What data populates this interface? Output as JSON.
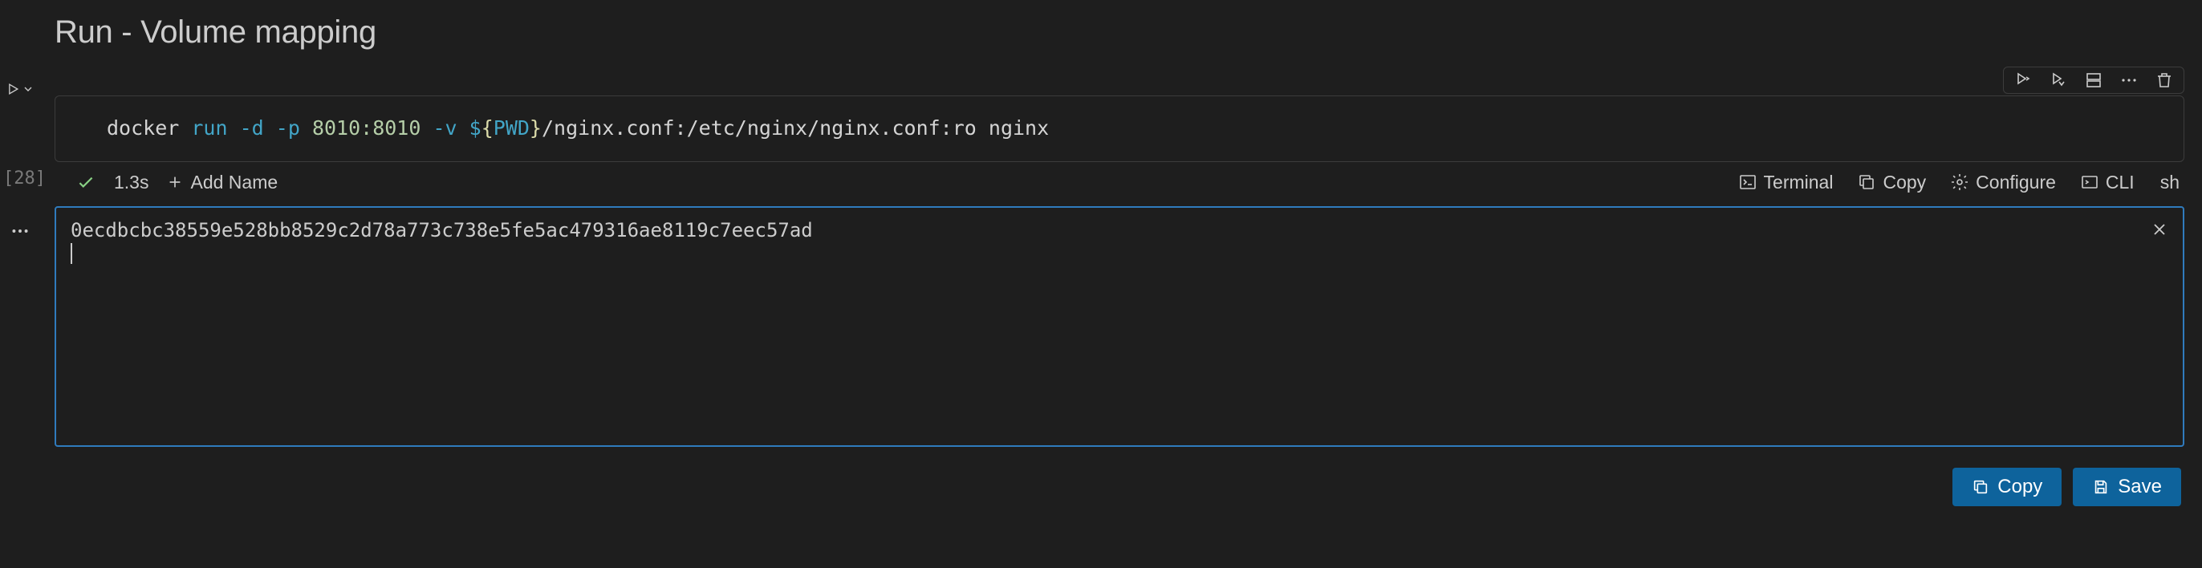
{
  "title": "Run - Volume mapping",
  "exec_count": "[28]",
  "code": {
    "cmd": "docker",
    "sub": "run",
    "flag_d": "-d",
    "flag_p": "-p",
    "ports": "8010:8010",
    "flag_v": "-v",
    "dollar": "$",
    "brace_open": "{",
    "pwd": "PWD",
    "brace_close": "}",
    "path": "/nginx.conf:/etc/nginx/nginx.conf:ro",
    "image": "nginx"
  },
  "status": {
    "duration": "1.3s",
    "add_name": "Add Name"
  },
  "actions": {
    "terminal": "Terminal",
    "copy": "Copy",
    "configure": "Configure",
    "cli": "CLI",
    "shell": "sh"
  },
  "output": "0ecdbcbc38559e528bb8529c2d78a773c738e5fe5ac479316ae8119c7eec57ad",
  "footer": {
    "copy": "Copy",
    "save": "Save"
  }
}
